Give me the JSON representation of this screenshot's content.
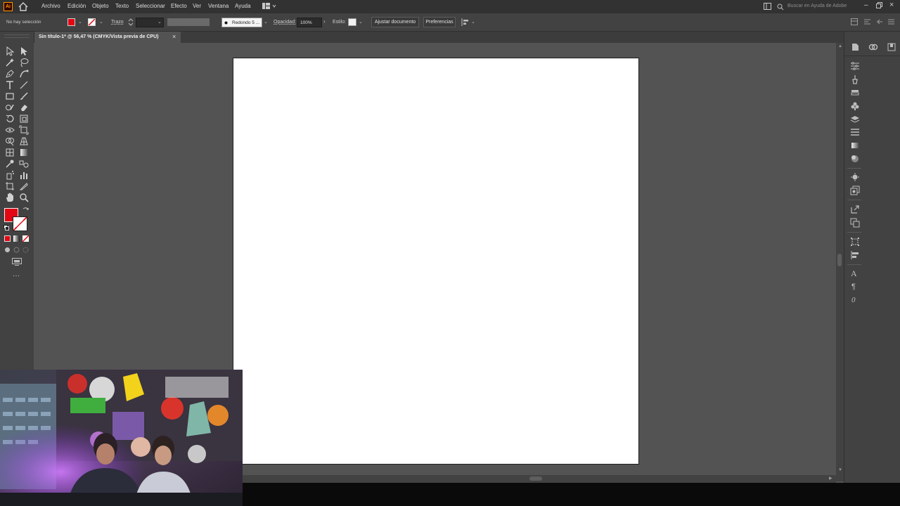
{
  "menubar": {
    "app_logo": "Ai",
    "items": [
      "Archivo",
      "Edición",
      "Objeto",
      "Texto",
      "Seleccionar",
      "Efecto",
      "Ver",
      "Ventana",
      "Ayuda"
    ],
    "search_placeholder": "Buscar en Ayuda de Adobe"
  },
  "controlbar": {
    "selection_status": "No hay selección",
    "stroke_label": "Trazo",
    "brush_label": "Redondo 5 ...",
    "opacity_label": "Opacidad:",
    "opacity_value": "100%",
    "style_label": "Estilo:",
    "document_setup_button": "Ajustar documento",
    "preferences_button": "Preferencias",
    "fill_color": "#e30613"
  },
  "document_tab": {
    "title": "Sin título-1* @ 56,47 % (CMYK/Vista previa de CPU)",
    "close": "×"
  },
  "toolbar": {
    "more_tools": "···"
  }
}
